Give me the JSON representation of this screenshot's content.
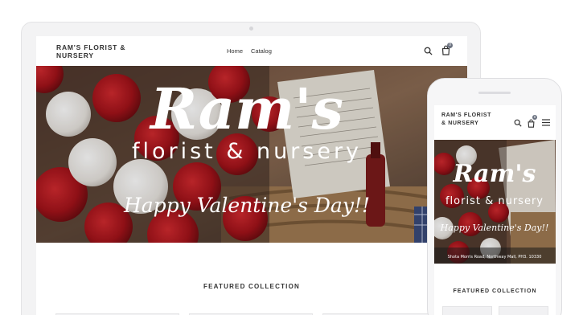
{
  "desktop": {
    "logo": "RAM'S FLORIST & NURSERY",
    "nav": [
      "Home",
      "Catalog"
    ],
    "cart_count": "0",
    "hero": {
      "title": "Ram's",
      "subtitle": "florist & nursery",
      "tagline": "Happy Valentine's Day!!"
    },
    "featured_heading": "FEATURED COLLECTION"
  },
  "mobile": {
    "logo": "RAM'S FLORIST & NURSERY",
    "cart_count": "0",
    "hero": {
      "title": "Ram's",
      "subtitle": "florist & nursery",
      "tagline": "Happy Valentine's Day!!",
      "address": "Shota Morris Road, Northway Mall, PH3. 10330"
    },
    "featured_heading": "FEATURED COLLECTION"
  },
  "icons": {
    "search": "search-icon",
    "cart": "cart-icon",
    "menu": "hamburger-menu-icon"
  },
  "colors": {
    "rose_red": "#b3161c",
    "badge": "#6b7280",
    "text": "#333333"
  }
}
